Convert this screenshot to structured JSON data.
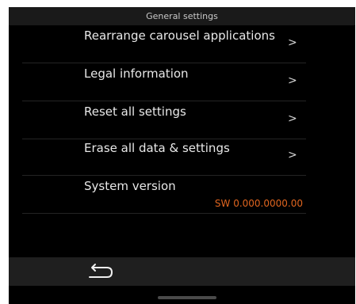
{
  "header": {
    "title": "General settings"
  },
  "settings": {
    "items": [
      {
        "label": "Rearrange carousel applications",
        "chevron": ">"
      },
      {
        "label": "Legal information",
        "chevron": ">"
      },
      {
        "label": "Reset all settings",
        "chevron": ">"
      },
      {
        "label": "Erase all data & settings",
        "chevron": ">"
      }
    ],
    "version": {
      "label": "System version",
      "value": "SW 0.000.0000.00"
    }
  },
  "bottom_bar": {
    "back_icon": "back-arrow-icon"
  },
  "colors": {
    "background": "#000000",
    "header_bg": "#1a1a1a",
    "accent": "#e0651f",
    "text": "#e8e8e8"
  }
}
